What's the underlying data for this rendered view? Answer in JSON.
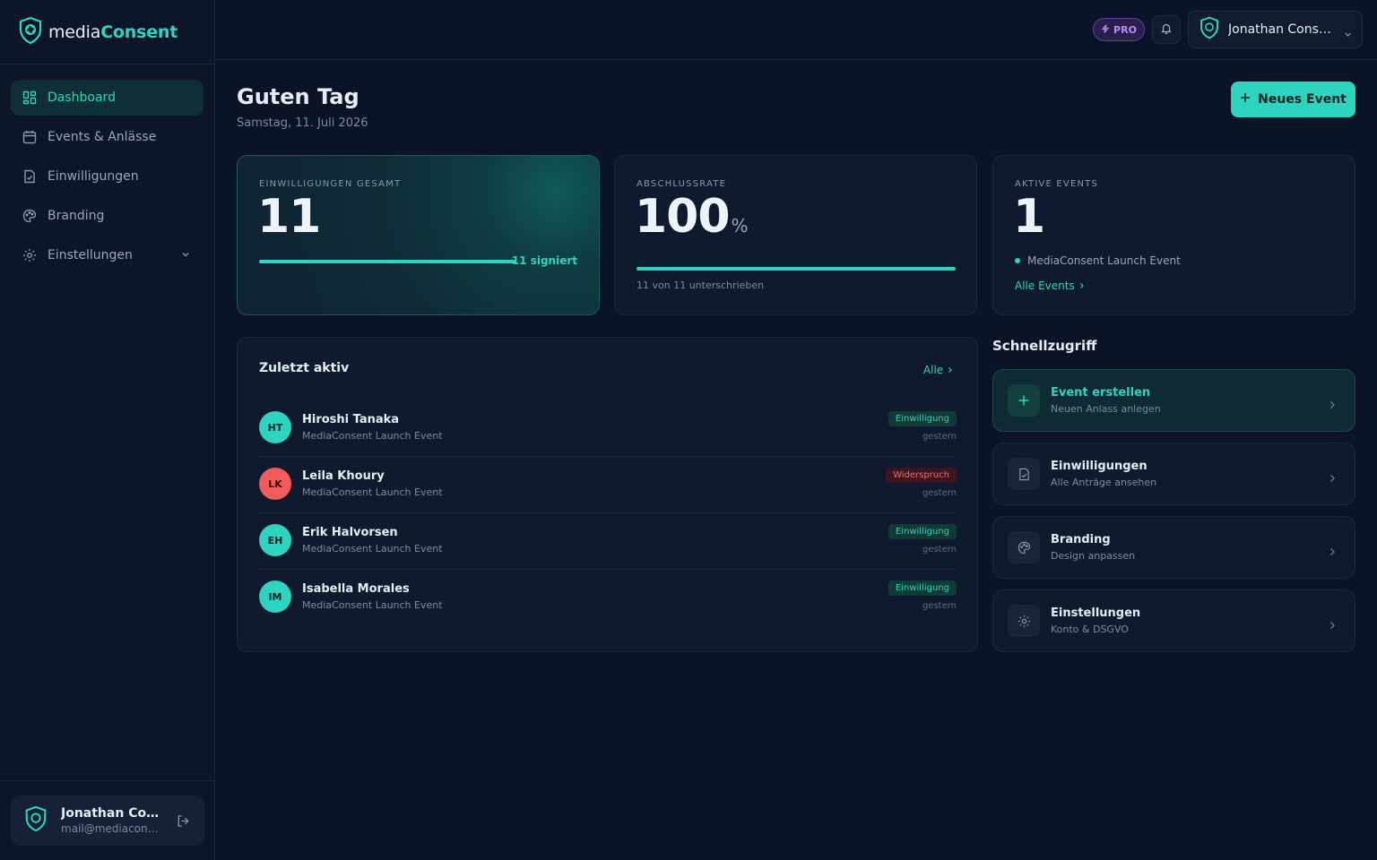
{
  "brand": {
    "name_part1": "media",
    "name_part2": "Consent"
  },
  "sidebar": {
    "items": [
      {
        "label": "Dashboard",
        "icon": "dashboard-icon",
        "active": true
      },
      {
        "label": "Events & Anlässe",
        "icon": "calendar-icon"
      },
      {
        "label": "Einwilligungen",
        "icon": "document-check-icon"
      },
      {
        "label": "Branding",
        "icon": "palette-icon"
      },
      {
        "label": "Einstellungen",
        "icon": "gear-icon",
        "expandable": true
      }
    ],
    "user": {
      "name": "Jonathan Consent",
      "email": "mail@mediaconsent.de"
    }
  },
  "topbar": {
    "pro_label": "PRO",
    "account_name": "Jonathan Consent"
  },
  "header": {
    "greeting": "Guten Tag",
    "date": "Samstag, 11. Juli 2026",
    "new_event_label": "Neues Event"
  },
  "stats": {
    "consents": {
      "label": "EINWILLIGUNGEN GESAMT",
      "value": "11",
      "signed_label": "11 signiert",
      "progress": 1.0
    },
    "completion": {
      "label": "ABSCHLUSSRATE",
      "value": "100",
      "unit": "%",
      "sub": "11 von 11 unterschrieben",
      "progress": 1.0
    },
    "events": {
      "label": "AKTIVE EVENTS",
      "value": "1",
      "event_name": "MediaConsent Launch Event",
      "link_label": "Alle Events"
    }
  },
  "recent": {
    "title": "Zuletzt aktiv",
    "all_label": "Alle",
    "rows": [
      {
        "initials": "HT",
        "name": "Hiroshi Tanaka",
        "event": "MediaConsent Launch Event",
        "status": "Einwilligung",
        "status_type": "ok",
        "when": "gestern"
      },
      {
        "initials": "LK",
        "name": "Leila Khoury",
        "event": "MediaConsent Launch Event",
        "status": "Widerspruch",
        "status_type": "no",
        "when": "gestern"
      },
      {
        "initials": "EH",
        "name": "Erik Halvorsen",
        "event": "MediaConsent Launch Event",
        "status": "Einwilligung",
        "status_type": "ok",
        "when": "gestern"
      },
      {
        "initials": "IM",
        "name": "Isabella Morales",
        "event": "MediaConsent Launch Event",
        "status": "Einwilligung",
        "status_type": "ok",
        "when": "gestern"
      }
    ]
  },
  "quick": {
    "title": "Schnellzugriff",
    "items": [
      {
        "title": "Event erstellen",
        "sub": "Neuen Anlass anlegen",
        "icon": "plus-icon"
      },
      {
        "title": "Einwilligungen",
        "sub": "Alle Anträge ansehen",
        "icon": "document-check-icon"
      },
      {
        "title": "Branding",
        "sub": "Design anpassen",
        "icon": "palette-icon"
      },
      {
        "title": "Einstellungen",
        "sub": "Konto & DSGVO",
        "icon": "gear-icon"
      }
    ]
  },
  "colors": {
    "accent": "#2dd4bf",
    "background": "#0b1426",
    "danger": "#f25b5b",
    "pro": "#b78cff"
  }
}
